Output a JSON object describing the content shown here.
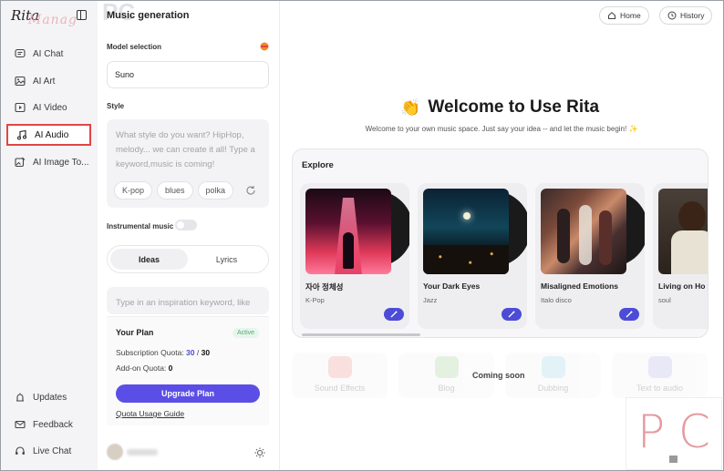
{
  "nav": {
    "brand": "Rita",
    "watermark": "Manag",
    "items": [
      {
        "label": "AI Chat",
        "icon": "chat-icon"
      },
      {
        "label": "AI Art",
        "icon": "image-icon"
      },
      {
        "label": "AI Video",
        "icon": "video-icon"
      },
      {
        "label": "AI Audio",
        "icon": "music-note-icon",
        "active": true
      },
      {
        "label": "AI Image To...",
        "icon": "image-edit-icon"
      }
    ],
    "bottom": [
      {
        "label": "Updates",
        "icon": "updates-icon"
      },
      {
        "label": "Feedback",
        "icon": "mail-icon"
      },
      {
        "label": "Live Chat",
        "icon": "headset-icon"
      }
    ]
  },
  "panel": {
    "title": "Music generation",
    "watermark": "PC",
    "model_label": "Model selection",
    "model_value": "Suno",
    "style_label": "Style",
    "style_placeholder": "What style do you want? HipHop, melody... we can create it all! Type a keyword,music is coming!",
    "style_chips": [
      "K-pop",
      "blues",
      "polka"
    ],
    "instrumental_label": "Instrumental music",
    "tabs": [
      "Ideas",
      "Lyrics"
    ],
    "inspiration_placeholder": "Type in an inspiration keyword, like",
    "plan": {
      "title": "Your Plan",
      "badge": "Active",
      "subscription_label": "Subscription Quota:",
      "subscription_used": "30",
      "subscription_sep": " / ",
      "subscription_total": "30",
      "addon_label": "Add-on Quota:",
      "addon_value": "0",
      "upgrade": "Upgrade Plan",
      "guide": "Quota Usage Guide"
    }
  },
  "header": {
    "home": "Home",
    "history": "History"
  },
  "welcome": {
    "emoji": "👏",
    "title": "Welcome to Use Rita",
    "subtitle": "Welcome to your own music space. Just say your idea -- and let the music begin! ✨"
  },
  "explore": {
    "title": "Explore",
    "cards": [
      {
        "title": "자아 정체성",
        "genre": "K-Pop"
      },
      {
        "title": "Your Dark Eyes",
        "genre": "Jazz"
      },
      {
        "title": "Misaligned Emotions",
        "genre": "Italo disco"
      },
      {
        "title": "Living on Ho",
        "genre": "soul"
      }
    ]
  },
  "coming_soon": {
    "label": "Coming soon",
    "items": [
      "Sound Effects",
      "Blog",
      "Dubbing",
      "Text to audio"
    ]
  },
  "corner_watermark": {
    "left": "P",
    "right": "C"
  },
  "colors": {
    "accent": "#5b4ee6",
    "highlight_border": "#e24444",
    "watermark": "#e59aa0"
  }
}
